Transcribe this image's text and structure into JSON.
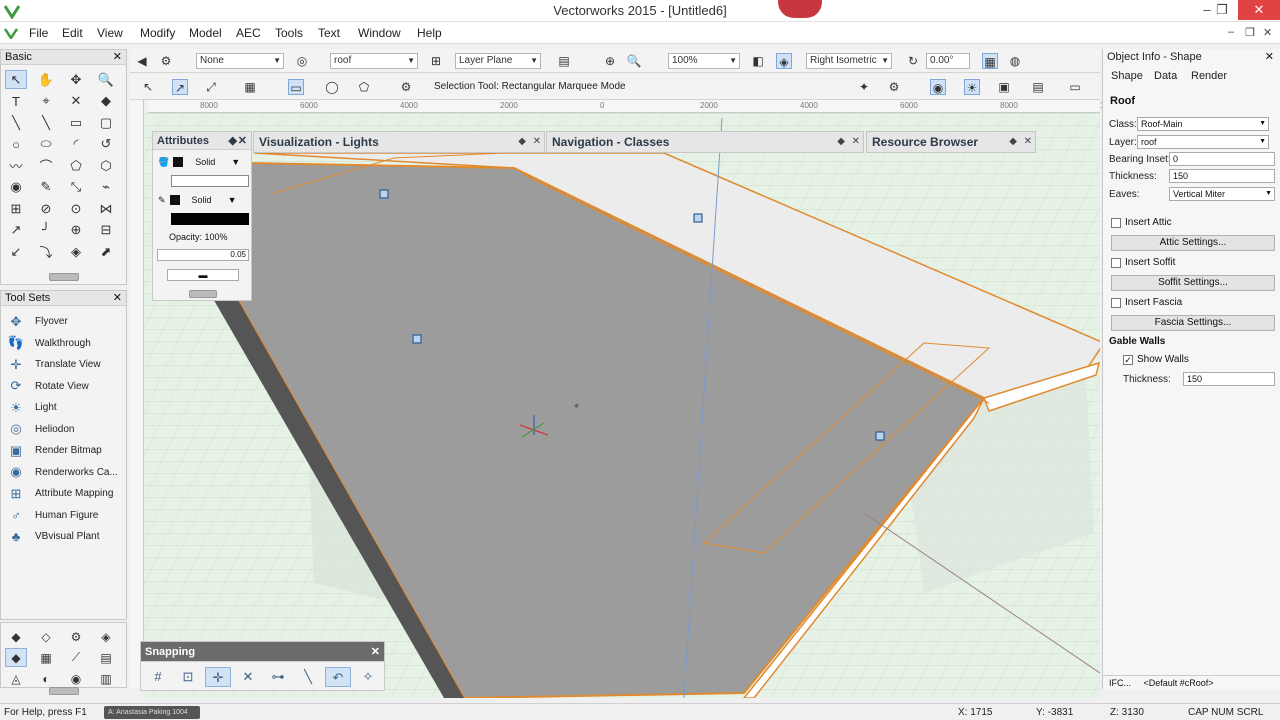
{
  "window": {
    "title": "Vectorworks 2015 - [Untitled6]",
    "controls": [
      "–",
      "❐",
      "✕"
    ]
  },
  "menubar": {
    "items": [
      "File",
      "Edit",
      "View",
      "Modify",
      "Model",
      "AEC",
      "Tools",
      "Text",
      "Window",
      "Help"
    ],
    "doc_controls": [
      "–",
      "❐",
      "✕"
    ]
  },
  "basic_palette": {
    "title": "Basic",
    "tools": [
      {
        "name": "selection-tool",
        "glyph": "↖"
      },
      {
        "name": "pan-tool",
        "glyph": "✋"
      },
      {
        "name": "flyover-tool",
        "glyph": "✥"
      },
      {
        "name": "zoom-tool",
        "glyph": "🔍"
      },
      {
        "name": "text-tool",
        "glyph": "T"
      },
      {
        "name": "callout-tool",
        "glyph": "⌖"
      },
      {
        "name": "locus-tool",
        "glyph": "✕"
      },
      {
        "name": "attribute-mapping-tool",
        "glyph": "◆"
      },
      {
        "name": "line-tool",
        "glyph": "╲"
      },
      {
        "name": "double-line-tool",
        "glyph": "╲"
      },
      {
        "name": "rectangle-tool",
        "glyph": "▭"
      },
      {
        "name": "rounded-rectangle-tool",
        "glyph": "▢"
      },
      {
        "name": "circle-tool",
        "glyph": "○"
      },
      {
        "name": "oval-tool",
        "glyph": "⬭"
      },
      {
        "name": "arc-tool",
        "glyph": "◜"
      },
      {
        "name": "quarter-arc-tool",
        "glyph": "↺"
      },
      {
        "name": "freehand-tool",
        "glyph": "〰"
      },
      {
        "name": "polyline-tool",
        "glyph": "⌒"
      },
      {
        "name": "polygon-tool",
        "glyph": "⬠"
      },
      {
        "name": "regular-polygon-tool",
        "glyph": "⬡"
      },
      {
        "name": "spiral-tool",
        "glyph": "◉"
      },
      {
        "name": "eyedropper-tool",
        "glyph": "✎"
      },
      {
        "name": "dimension-tool",
        "glyph": "⤡"
      },
      {
        "name": "constrained-tool",
        "glyph": "⌁"
      },
      {
        "name": "reshape-tool",
        "glyph": "⊞"
      },
      {
        "name": "split-tool",
        "glyph": "⊘"
      },
      {
        "name": "offset-tool",
        "glyph": "⊙"
      },
      {
        "name": "mirror-tool",
        "glyph": "⋈"
      },
      {
        "name": "rotate-tool",
        "glyph": "↗"
      },
      {
        "name": "fillet-tool",
        "glyph": "╯"
      },
      {
        "name": "connect-tool",
        "glyph": "⊕"
      },
      {
        "name": "trim-tool",
        "glyph": "⊟"
      },
      {
        "name": "chamfer-tool",
        "glyph": "↙"
      },
      {
        "name": "clip-tool",
        "glyph": "⤵"
      },
      {
        "name": "render-tool",
        "glyph": "◈"
      },
      {
        "name": "space-tool",
        "glyph": "⬈"
      }
    ]
  },
  "toolsets_palette": {
    "title": "Tool Sets",
    "items": [
      {
        "label": "Flyover",
        "glyph": "✥"
      },
      {
        "label": "Walkthrough",
        "glyph": "👣"
      },
      {
        "label": "Translate View",
        "glyph": "✛"
      },
      {
        "label": "Rotate View",
        "glyph": "⟳"
      },
      {
        "label": "Light",
        "glyph": "☀"
      },
      {
        "label": "Heliodon",
        "glyph": "◎"
      },
      {
        "label": "Render Bitmap",
        "glyph": "▣"
      },
      {
        "label": "Renderworks Ca...",
        "glyph": "◉"
      },
      {
        "label": "Attribute Mapping",
        "glyph": "⊞"
      },
      {
        "label": "Human Figure",
        "glyph": "♂"
      },
      {
        "label": "VBvisual Plant",
        "glyph": "♣"
      }
    ]
  },
  "bottom_toolsets": [
    "◆",
    "◇",
    "⚙",
    "◈",
    "◆",
    "▦",
    "⟋",
    "▤",
    "◬",
    "◐",
    "◉",
    "▥"
  ],
  "view_bar": {
    "class_value": "None",
    "layer_value": "roof",
    "plane_value": "Layer Plane",
    "zoom_value": "100%",
    "view_value": "Right Isometric",
    "rotation_value": "0.00°"
  },
  "mode_bar": {
    "mode_text": "Selection Tool: Rectangular Marquee Mode"
  },
  "ruler": {
    "ticks": [
      "8000",
      "6000",
      "4000",
      "2000",
      "0",
      "2000",
      "4000",
      "6000",
      "8000",
      "10000"
    ]
  },
  "attributes_palette": {
    "title": "Attributes",
    "fill_style": "Solid",
    "pen_style": "Solid",
    "opacity_label": "Opacity: 100%",
    "line_weight": "0.05"
  },
  "docked_tabs": [
    {
      "title": "Visualization - Lights"
    },
    {
      "title": "Navigation - Classes"
    },
    {
      "title": "Resource Browser"
    }
  ],
  "snapping_palette": {
    "title": "Snapping",
    "buttons": [
      {
        "name": "snap-to-grid",
        "glyph": "#",
        "on": false
      },
      {
        "name": "snap-to-object",
        "glyph": "⊡",
        "on": false
      },
      {
        "name": "snap-to-intersection",
        "glyph": "✛",
        "on": true
      },
      {
        "name": "snap-to-distance",
        "glyph": "✕",
        "on": false
      },
      {
        "name": "snap-to-angle",
        "glyph": "⊶",
        "on": false
      },
      {
        "name": "smart-points",
        "glyph": "╲",
        "on": false
      },
      {
        "name": "smart-edge",
        "glyph": "↶",
        "on": true
      },
      {
        "name": "snap-to-tangent",
        "glyph": "✧",
        "on": false
      }
    ]
  },
  "object_info": {
    "title": "Object Info - Shape",
    "tabs": [
      "Shape",
      "Data",
      "Render"
    ],
    "object_type": "Roof",
    "class_label": "Class:",
    "class_value": "Roof-Main",
    "layer_label": "Layer:",
    "layer_value": "roof",
    "bearing_label": "Bearing Inset:",
    "bearing_value": "0",
    "thickness_label": "Thickness:",
    "thickness_value": "150",
    "eaves_label": "Eaves:",
    "eaves_value": "Vertical Miter",
    "insert_attic": "Insert Attic",
    "attic_settings": "Attic Settings...",
    "insert_soffit": "Insert Soffit",
    "soffit_settings": "Soffit Settings...",
    "insert_fascia": "Insert Fascia",
    "fascia_settings": "Fascia Settings...",
    "gable_walls_label": "Gable Walls",
    "show_walls": "Show Walls",
    "gable_thickness_label": "Thickness:",
    "gable_thickness_value": "150",
    "footer_ifc": "IFC...",
    "footer_record": "<Default #cRoof>"
  },
  "status": {
    "help_text": "For Help, press F1",
    "taskbar_chip": "A: Anastasia Paking 1004",
    "x_coord": "X: 1715",
    "y_coord": "Y: -3831",
    "z_coord": "Z: 3130",
    "indicators": "CAP NUM SCRL"
  }
}
